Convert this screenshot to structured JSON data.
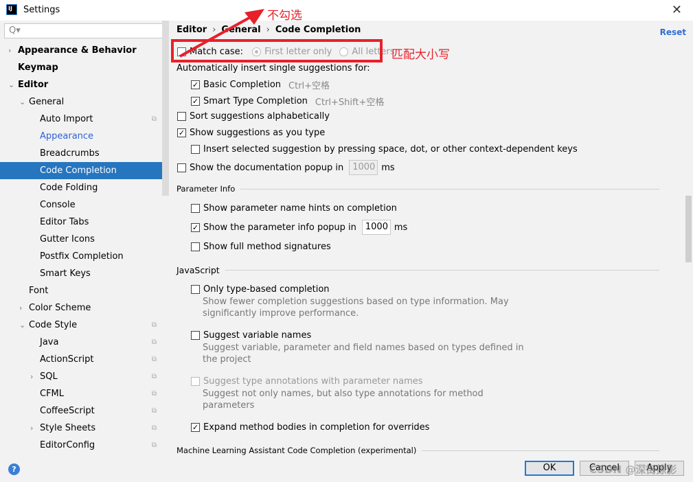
{
  "window": {
    "title": "Settings",
    "close": "✕"
  },
  "search": {
    "placeholder": "Q▾"
  },
  "tree": [
    {
      "label": "Appearance & Behavior",
      "level": 0,
      "arrow": "›",
      "bold": true
    },
    {
      "label": "Keymap",
      "level": 0,
      "bold": true
    },
    {
      "label": "Editor",
      "level": 0,
      "arrow": "⌄",
      "bold": true
    },
    {
      "label": "General",
      "level": 1,
      "arrow": "⌄"
    },
    {
      "label": "Auto Import",
      "level": 2,
      "copy": true
    },
    {
      "label": "Appearance",
      "level": 2,
      "link": true
    },
    {
      "label": "Breadcrumbs",
      "level": 2
    },
    {
      "label": "Code Completion",
      "level": 2,
      "selected": true
    },
    {
      "label": "Code Folding",
      "level": 2
    },
    {
      "label": "Console",
      "level": 2
    },
    {
      "label": "Editor Tabs",
      "level": 2
    },
    {
      "label": "Gutter Icons",
      "level": 2
    },
    {
      "label": "Postfix Completion",
      "level": 2
    },
    {
      "label": "Smart Keys",
      "level": 2
    },
    {
      "label": "Font",
      "level": 1
    },
    {
      "label": "Color Scheme",
      "level": 1,
      "arrow": "›"
    },
    {
      "label": "Code Style",
      "level": 1,
      "arrow": "⌄",
      "copy": true
    },
    {
      "label": "Java",
      "level": 2,
      "copy": true
    },
    {
      "label": "ActionScript",
      "level": 2,
      "copy": true
    },
    {
      "label": "SQL",
      "level": 2,
      "arrow": "›",
      "copy": true
    },
    {
      "label": "CFML",
      "level": 2,
      "copy": true
    },
    {
      "label": "CoffeeScript",
      "level": 2,
      "copy": true
    },
    {
      "label": "Style Sheets",
      "level": 2,
      "arrow": "›",
      "copy": true
    },
    {
      "label": "EditorConfig",
      "level": 2,
      "copy": true
    }
  ],
  "breadcrumb": [
    "Editor",
    "General",
    "Code Completion"
  ],
  "reset": "Reset",
  "match_case": {
    "label": "Match case:",
    "checked": false,
    "opt1": "First letter only",
    "opt2": "All letters",
    "selected": "First letter only"
  },
  "auto_insert": "Automatically insert single suggestions for:",
  "basic": {
    "label": "Basic Completion",
    "shortcut": "Ctrl+空格",
    "checked": true
  },
  "smart": {
    "label": "Smart Type Completion",
    "shortcut": "Ctrl+Shift+空格",
    "checked": true
  },
  "sort": {
    "label": "Sort suggestions alphabetically",
    "checked": false
  },
  "show_as_type": {
    "label": "Show suggestions as you type",
    "checked": true
  },
  "insert_selected": {
    "label": "Insert selected suggestion by pressing space, dot, or other context-dependent keys",
    "checked": false
  },
  "doc_popup": {
    "label": "Show the documentation popup in",
    "value": "1000",
    "unit": "ms",
    "checked": false
  },
  "param_info": {
    "title": "Parameter Info",
    "hints": {
      "label": "Show parameter name hints on completion",
      "checked": false
    },
    "popup": {
      "label": "Show the parameter info popup in",
      "value": "1000",
      "unit": "ms",
      "checked": true
    },
    "full": {
      "label": "Show full method signatures",
      "checked": false
    }
  },
  "js": {
    "title": "JavaScript",
    "type_based": {
      "label": "Only type-based completion",
      "checked": false,
      "desc1": "Show fewer completion suggestions based on type information. May",
      "desc2": "significantly improve performance."
    },
    "var_names": {
      "label": "Suggest variable names",
      "checked": false,
      "desc1": "Suggest variable, parameter and field names based on types defined in",
      "desc2": "the project"
    },
    "type_annot": {
      "label": "Suggest type annotations with parameter names",
      "checked": false,
      "desc1": "Suggest not only names, but also type annotations for method",
      "desc2": "parameters"
    },
    "expand": {
      "label": "Expand method bodies in completion for overrides",
      "checked": true
    }
  },
  "ml_section": "Machine Learning Assistant Code Completion (experimental)",
  "footer": {
    "help": "?",
    "ok": "OK",
    "cancel": "Cancel",
    "apply": "Apply"
  },
  "annotations": {
    "arrow_text": "不勾选",
    "box_text": "匹配大小写",
    "color": "#e8202a"
  },
  "watermark": "CSDN @深街掠影"
}
